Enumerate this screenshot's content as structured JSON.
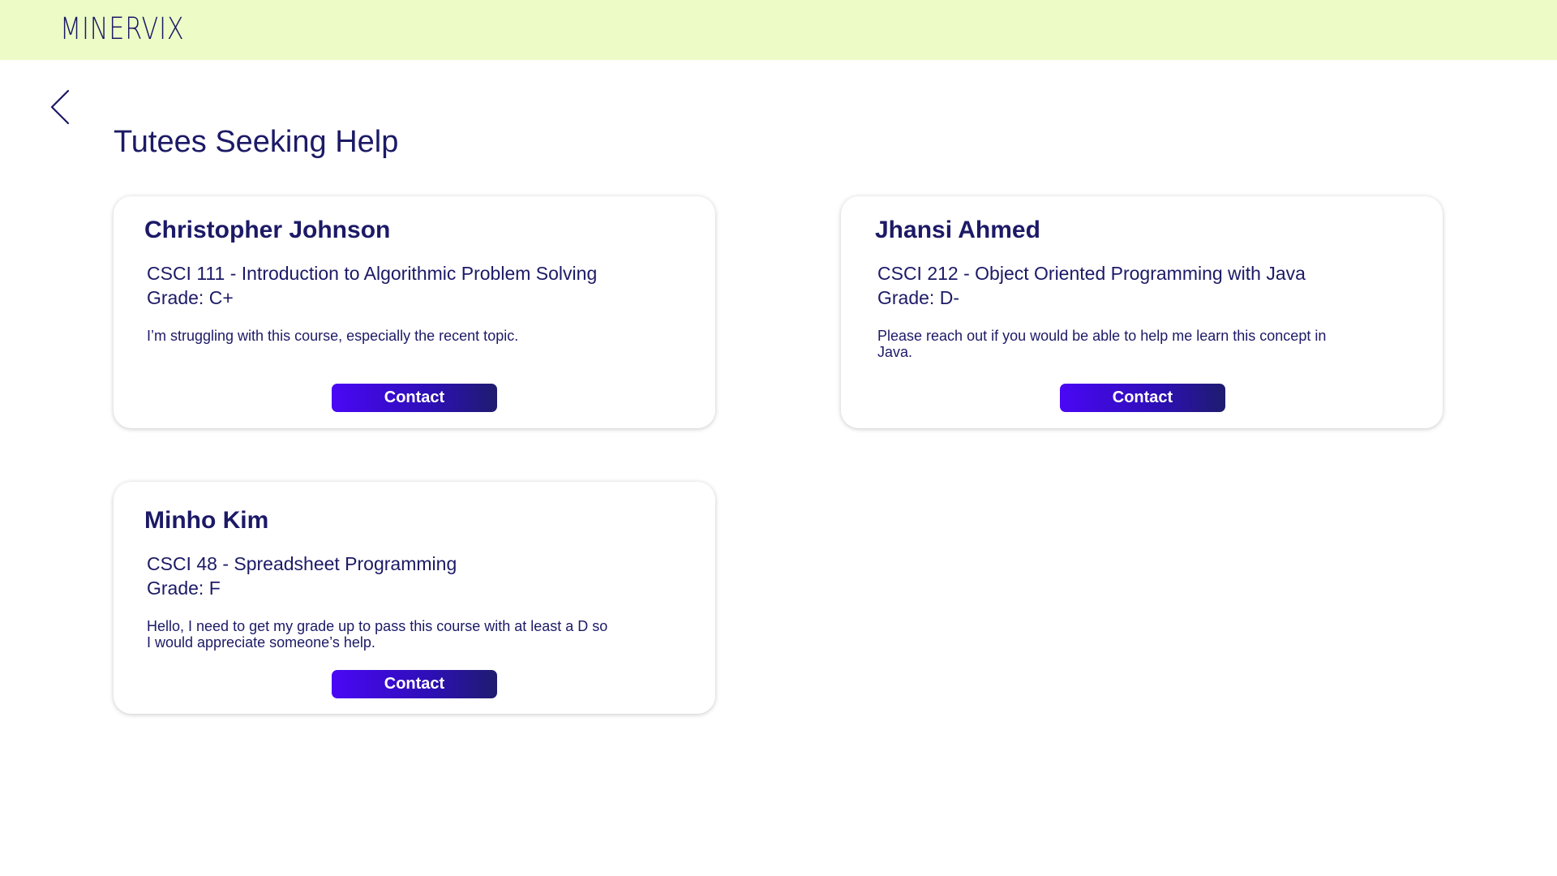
{
  "header": {
    "logo_text": "MINERVIX",
    "background_color": "#edfcc7"
  },
  "navigation": {
    "back_icon": "chevron-left-icon"
  },
  "page": {
    "title": "Tutees Seeking Help"
  },
  "colors": {
    "text": "#1c1a66",
    "button_gradient_start": "#4a07f5",
    "button_gradient_end": "#1f1c6e"
  },
  "tutees": [
    {
      "name": "Christopher Johnson",
      "course": "CSCI 111 - Introduction to Algorithmic Problem Solving",
      "grade": "Grade: C+",
      "message": "I’m struggling with this course, especially the recent topic.",
      "contact_label": "Contact"
    },
    {
      "name": "Jhansi Ahmed",
      "course": "CSCI 212 - Object Oriented Programming with Java",
      "grade": "Grade: D-",
      "message": "Please reach out if you would be able to help me learn this concept in Java.",
      "contact_label": "Contact"
    },
    {
      "name": "Minho Kim",
      "course": "CSCI 48 - Spreadsheet Programming",
      "grade": "Grade: F",
      "message": "Hello, I need to get my grade up to pass this course with at least a D so I would appreciate someone’s help.",
      "contact_label": "Contact"
    }
  ]
}
